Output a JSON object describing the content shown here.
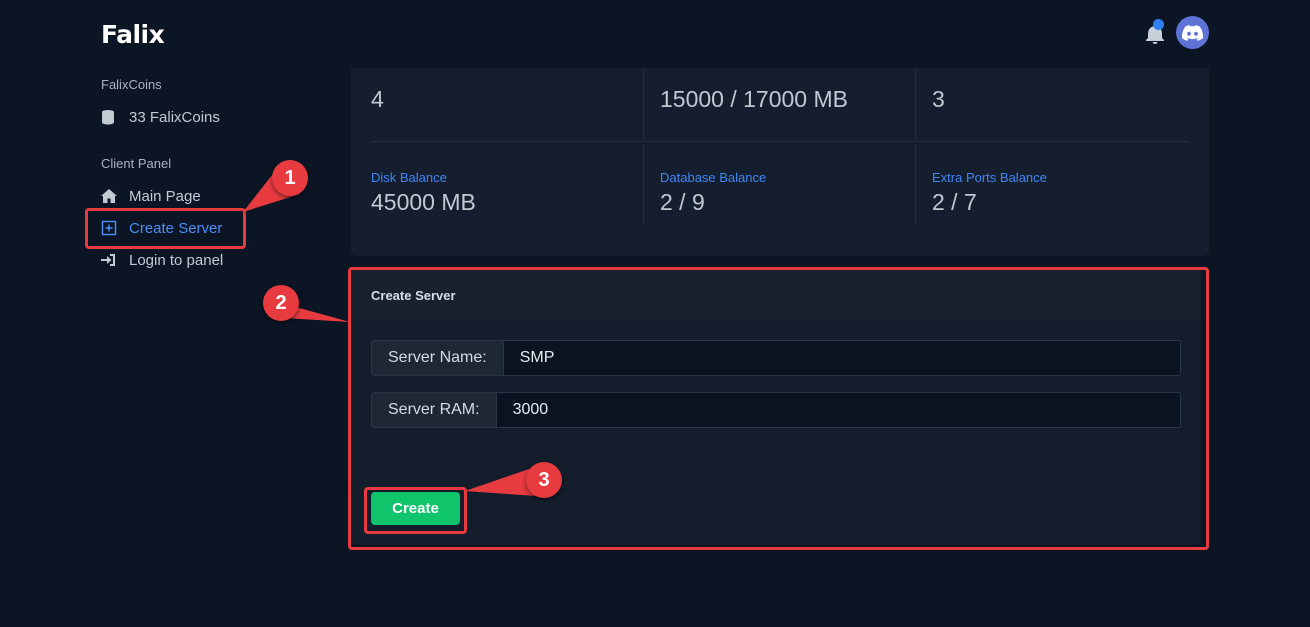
{
  "app": {
    "logo": "Falix"
  },
  "header": {
    "bell_icon": "bell-icon",
    "avatar_icon": "discord-icon",
    "accent": "#2f7ff5"
  },
  "sidebar": {
    "coins_heading": "FalixCoins",
    "coins_value": "33 FalixCoins",
    "panel_heading": "Client Panel",
    "items": [
      {
        "label": "Main Page",
        "icon": "home-icon"
      },
      {
        "label": "Create Server",
        "icon": "plus-square-icon",
        "active": true
      },
      {
        "label": "Login to panel",
        "icon": "sign-in-icon"
      }
    ]
  },
  "stats": {
    "row1": [
      {
        "value": "4"
      },
      {
        "value": "15000 / 17000 MB"
      },
      {
        "value": "3"
      }
    ],
    "row2": [
      {
        "label": "Disk Balance",
        "value": "45000 MB"
      },
      {
        "label": "Database Balance",
        "value": "2 / 9"
      },
      {
        "label": "Extra Ports Balance",
        "value": "2 / 7"
      }
    ],
    "label_color": "#3f86f4"
  },
  "create_form": {
    "title": "Create Server",
    "name_label": "Server Name:",
    "name_value": "SMP",
    "ram_label": "Server RAM:",
    "ram_value": "3000",
    "submit_label": "Create",
    "submit_color": "#0fc46a"
  },
  "annotations": {
    "color": "#e83b40",
    "badges": [
      "1",
      "2",
      "3"
    ]
  }
}
